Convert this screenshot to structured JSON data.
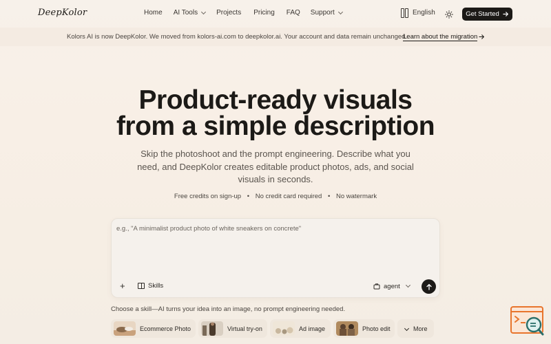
{
  "brand": {
    "logo_text": "DeepKolor"
  },
  "nav": {
    "items": [
      {
        "label": "Home",
        "has_dropdown": false
      },
      {
        "label": "AI Tools",
        "has_dropdown": true
      },
      {
        "label": "Projects",
        "has_dropdown": false
      },
      {
        "label": "Pricing",
        "has_dropdown": false
      },
      {
        "label": "FAQ",
        "has_dropdown": false
      },
      {
        "label": "Support",
        "has_dropdown": true
      }
    ],
    "language": "English",
    "theme_icon": "sun-icon",
    "cta_label": "Get Started",
    "cta_icon": "arrow-right-icon"
  },
  "banner": {
    "message": "Kolors AI is now DeepKolor. We moved from kolors-ai.com to deepkolor.ai. Your account and data remain unchanged.",
    "link_label": "Learn about the migration",
    "link_icon": "arrow-right-icon"
  },
  "hero": {
    "title_line1": "Product-ready visuals",
    "title_line2": "from a simple description",
    "subtitle": "Skip the photoshoot and the prompt engineering. Describe what you need, and DeepKolor creates editable product photos, ads, and social visuals in seconds.",
    "perks": [
      "Free credits on sign-up",
      "No credit card required",
      "No watermark"
    ],
    "perk_separator": "•"
  },
  "prompt": {
    "placeholder": "e.g., \"A minimalist product photo of white sneakers on concrete\"",
    "value": "",
    "plus_label": "+",
    "skills_label": "Skills",
    "mode_label": "agent",
    "send_icon": "arrow-up-icon"
  },
  "skills_hint": "Choose a skill—AI turns your idea into an image, no prompt engineering needed.",
  "skill_chips": [
    {
      "label": "Ecommerce Photo",
      "thumb_color": "#c9a27d"
    },
    {
      "label": "Virtual try-on",
      "thumb_color": "#6b5a48"
    },
    {
      "label": "Ad image",
      "thumb_color": "#cfc2ae"
    },
    {
      "label": "Photo edit",
      "thumb_color": "#8a6a45"
    },
    {
      "label": "More",
      "thumb_color": ""
    }
  ],
  "colors": {
    "accent": "#1c1a17",
    "background": "#f7f0e8",
    "widget_orange": "#e8742c",
    "widget_teal": "#2a6f6a"
  }
}
